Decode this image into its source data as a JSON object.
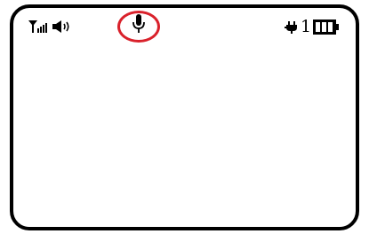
{
  "status_bar": {
    "signal_icon": "signal-antenna-icon",
    "volume_icon": "speaker-volume-icon",
    "mic_icon": "microphone-icon",
    "mic_highlighted": true,
    "highlight_color": "#d9212b",
    "power_icon": "power-plug-icon",
    "battery_count": "1",
    "battery_icon": "battery-full-icon",
    "battery_level": 1.0
  },
  "screen": {
    "border_color": "#000000",
    "background": "#ffffff"
  }
}
